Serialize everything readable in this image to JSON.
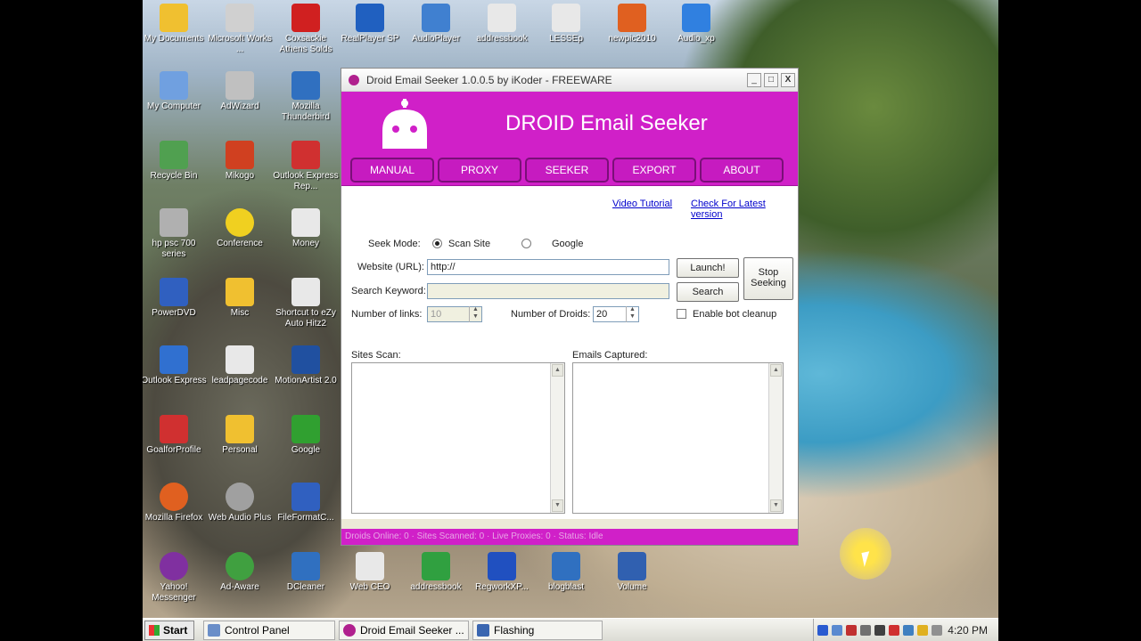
{
  "desktop": {
    "icons": [
      {
        "label": "My Documents",
        "color": "#f0c030"
      },
      {
        "label": "Microsoft Works ...",
        "color": "#d0d0d0"
      },
      {
        "label": "Coxsackie Athens Solds",
        "color": "#d02020"
      },
      {
        "label": "RealPlayer SP",
        "color": "#2060c0"
      },
      {
        "label": "AudioPlayer",
        "color": "#4080d0"
      },
      {
        "label": "addressbook",
        "color": "#e8e8e8"
      },
      {
        "label": "LESSEp",
        "color": "#e8e8e8"
      },
      {
        "label": "newpic2010",
        "color": "#e06020"
      },
      {
        "label": "Audio_xp",
        "color": "#3080e0"
      },
      {
        "label": "My Computer",
        "color": "#70a0e0"
      },
      {
        "label": "AdWizard",
        "color": "#c0c0c0"
      },
      {
        "label": "Mozilla Thunderbird",
        "color": "#3070c0"
      },
      {
        "label": "Recycle Bin",
        "color": "#50a050"
      },
      {
        "label": "Mikogo",
        "color": "#d04020"
      },
      {
        "label": "Outlook Express Rep...",
        "color": "#d03030"
      },
      {
        "label": "hp psc 700 series",
        "color": "#b0b0b0"
      },
      {
        "label": "Conference",
        "color": "#f0d020"
      },
      {
        "label": "Money",
        "color": "#e8e8e8"
      },
      {
        "label": "PowerDVD",
        "color": "#3060c0"
      },
      {
        "label": "Misc",
        "color": "#f0c030"
      },
      {
        "label": "Shortcut to eZy Auto Hitz2",
        "color": "#e8e8e8"
      },
      {
        "label": "Outlook Express",
        "color": "#3070d0"
      },
      {
        "label": "leadpagecode",
        "color": "#e8e8e8"
      },
      {
        "label": "MotionArtist 2.0",
        "color": "#2050a0"
      },
      {
        "label": "GoalforProfile",
        "color": "#d03030"
      },
      {
        "label": "Personal",
        "color": "#f0c030"
      },
      {
        "label": "Google",
        "color": "#30a030"
      },
      {
        "label": "Mozilla Firefox",
        "color": "#e06020"
      },
      {
        "label": "Web Audio Plus",
        "color": "#a0a0a0"
      },
      {
        "label": "FileFormatC...",
        "color": "#3060c0"
      },
      {
        "label": "Yahoo! Messenger",
        "color": "#8030a0"
      },
      {
        "label": "Ad-Aware",
        "color": "#40a040"
      },
      {
        "label": "DCleaner",
        "color": "#3070c0"
      },
      {
        "label": "Web CEO",
        "color": "#e8e8e8"
      },
      {
        "label": "addressbook",
        "color": "#30a040"
      },
      {
        "label": "RegworkXP...",
        "color": "#2050c0"
      },
      {
        "label": "blogblast",
        "color": "#3070c0"
      },
      {
        "label": "Volume",
        "color": "#3060b0"
      }
    ]
  },
  "window": {
    "title": "Droid Email Seeker 1.0.0.5 by iKoder - FREEWARE",
    "minimize": "_",
    "maximize": "□",
    "close": "X",
    "app_title": "DROID Email Seeker",
    "nav": [
      "MANUAL",
      "PROXY",
      "SEEKER",
      "EXPORT",
      "ABOUT"
    ],
    "links": {
      "video": "Video Tutorial",
      "check": "Check For Latest version"
    },
    "seek_mode_label": "Seek Mode:",
    "radio_scan": "Scan Site",
    "radio_google": "Google",
    "website_label": "Website (URL):",
    "website_value": "http://",
    "keyword_label": "Search Keyword:",
    "keyword_value": "",
    "launch": "Launch!",
    "search": "Search",
    "stop": "Stop Seeking",
    "links_label": "Number of links:",
    "links_value": "10",
    "droids_label": "Number of Droids:",
    "droids_value": "20",
    "cleanup": "Enable bot cleanup",
    "sites_label": "Sites Scan:",
    "emails_label": "Emails Captured:",
    "status": "Droids Online: 0 · Sites Scanned: 0 · Live Proxies: 0 · Status: Idle",
    "accent": "#d020c8"
  },
  "taskbar": {
    "start": "Start",
    "tasks": [
      "Control Panel",
      "Droid Email Seeker ...",
      "Flashing"
    ],
    "clock": "4:20 PM"
  }
}
